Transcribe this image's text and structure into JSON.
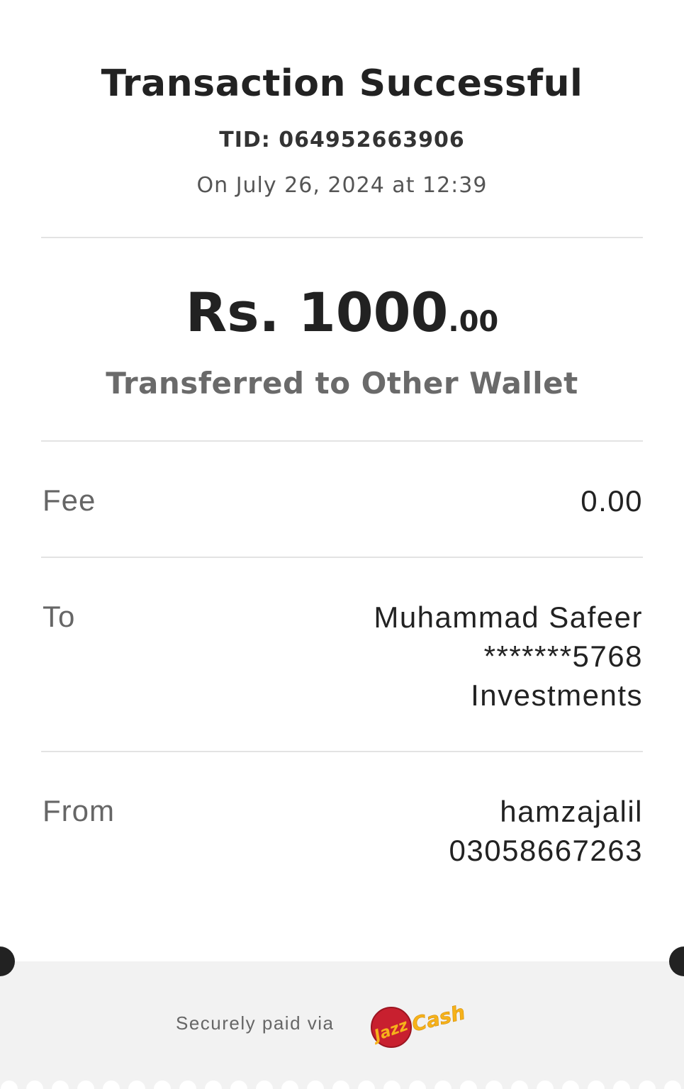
{
  "header": {
    "title": "Transaction Successful",
    "tid": "TID: 064952663906",
    "datetime": "On July 26, 2024 at 12:39"
  },
  "amount": {
    "main": "Rs. 1000",
    "cents": ".00",
    "description": "Transferred to Other Wallet"
  },
  "details": {
    "fee": {
      "label": "Fee",
      "value": "0.00"
    },
    "to": {
      "label": "To",
      "name": "Muhammad Safeer",
      "account": "*******5768",
      "note": "Investments"
    },
    "from": {
      "label": "From",
      "name": "hamzajalil",
      "account": "03058667263"
    }
  },
  "footer": {
    "secure_text": "Securely paid via",
    "logo": "JazzCash",
    "logo_colors": {
      "red": "#c8202f",
      "yellow": "#f6b21a"
    }
  },
  "colors": {
    "text_dark": "#222222",
    "text_muted": "#666666",
    "divider": "#e3e3e3",
    "footer_bg": "#f2f2f2"
  }
}
